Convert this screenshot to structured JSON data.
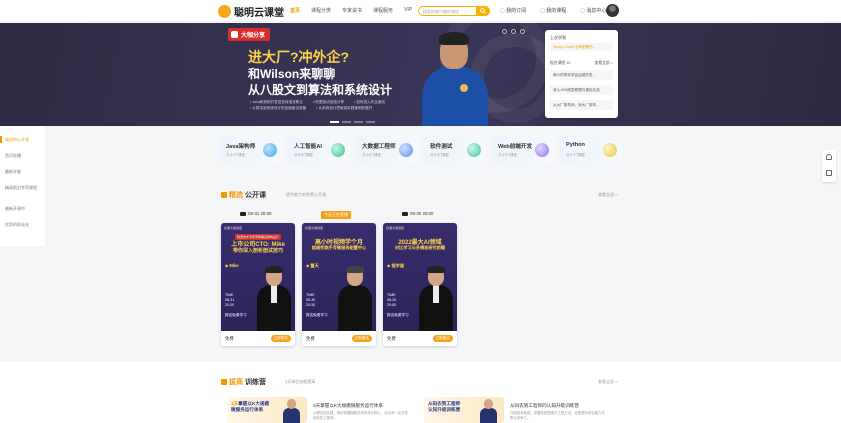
{
  "header": {
    "logo_text": "聪明云课堂",
    "nav": [
      "首页",
      "课程分类",
      "专家说书",
      "课程服务",
      "VIP"
    ],
    "search_placeholder": "搜索你感兴趣的课程",
    "links": [
      "我的订阅",
      "我的课程",
      "消息中心"
    ]
  },
  "banner": {
    "badge": "大咖分享",
    "line1": "进大厂?冲外企?",
    "line2": "和Wilson来聊聊",
    "line3": "从八股文到算法和系统设计",
    "bullets": [
      [
        "• Java和其他开发语言转语言职业",
        "• 阿里面试经验分享",
        "• 如何进入外企面试"
      ],
      [
        "• 从算法到系统设计的全面面试准备",
        "• 从系统设计思维到实践案例的展开"
      ]
    ]
  },
  "learning": {
    "title": "上次学到",
    "continue": "Spring Cloud 全局配置的...",
    "section": "报名课程 10",
    "more": "查看全部 >",
    "items": [
      "两小时带你学会后端开发...",
      "深入JVM底层原理与调优实战",
      "从大厂架构师，到大厂架构..."
    ]
  },
  "side_menu": [
    "精选的公开课",
    "首页轮播",
    "最新学者",
    "精选前沿专项课程",
    "最新开课中",
    "优质的职业化"
  ],
  "categories": [
    {
      "title": "Java架构师",
      "sub": "共计4门课程",
      "color": "#47a4e8"
    },
    {
      "title": "人工智能AI",
      "sub": "共计8门课程",
      "color": "#3cc193"
    },
    {
      "title": "大数据工程师",
      "sub": "共计6门课程",
      "color": "#5a8ef2"
    },
    {
      "title": "软件测试",
      "sub": "共计3门课程",
      "color": "#43c69c"
    },
    {
      "title": "Web前端开发",
      "sub": "共计5门课程",
      "color": "#8f74e6"
    },
    {
      "title": "Python",
      "sub": "共计7门课程",
      "color": "#7ad0a2"
    }
  ],
  "open_section": {
    "title_a": "精选",
    "title_b": "公开课",
    "sub": "提升能力的免费公开课",
    "more": "查看全部 >"
  },
  "live_tag": "今天正在直播",
  "live_cards": [
    {
      "date": "08-31 20:30",
      "top": "好课大咖讲座",
      "chip": "阿里技术专家带你解读架构设计",
      "h1": "上市公司CTO: Mike",
      "h2": "带你深入剖析面试技巧",
      "name": "◆ Mike",
      "time": "TIME\n08-31\n20:30",
      "free": "报名免费学习",
      "foot_free": "免费",
      "button": "立即报名"
    },
    {
      "date": "",
      "top": "好课大咖讲座",
      "chip": "",
      "h1": "高小时视频学个月",
      "h2": "超稳性跳手写微服务配置中心",
      "name": "◆ 董天",
      "time": "TIME\n08-30\n20:30",
      "free": "报名免费学习",
      "foot_free": "免费",
      "button": "立即报名"
    },
    {
      "date": "08-30 20:00",
      "top": "好课大咖讲座",
      "chip": "",
      "h1": "2022最大AI领域",
      "h2": "对比学习与多模态研究前瞻",
      "name": "◆ 程学道",
      "time": "TIME\n08-30\n20:00",
      "free": "报名免费学习",
      "foot_free": "免费",
      "button": "立即报名"
    }
  ],
  "training_section": {
    "title_a": "拔高",
    "title_b": "训练营",
    "sub": "3天体验技能提高",
    "more": "查看全部 >"
  },
  "training_cards": [
    {
      "thumb_a": "3天",
      "thumb_b": "掌握以K大规模\n微服务运行体系",
      "title": "3天掌握以K大规模微服务运行体系",
      "desc": "从理论到实践，带你掌握微服务架构设计核心，适合有一定开发经验的工程师。"
    },
    {
      "thumb_a": "",
      "thumb_b": "从码农到工程师\n认知升级训练营",
      "title": "从码农到工程师的认知升级训练营",
      "desc": "打破技术瓶颈，掌握系统思维与工程方法，全面提升综合能力与职业竞争力。"
    }
  ]
}
